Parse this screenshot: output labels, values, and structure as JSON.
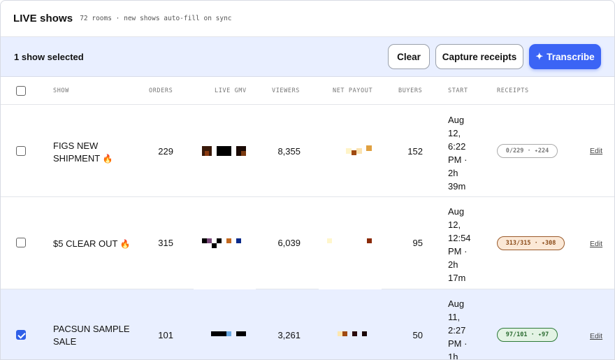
{
  "header": {
    "title": "LIVE shows",
    "subtitle": "72 rooms · new shows auto-fill on sync"
  },
  "actionbar": {
    "selected_label": "1 show selected",
    "clear_label": "Clear",
    "capture_label": "Capture receipts",
    "transcribe_label": "Transcribe",
    "transcribe_icon": "sparkle-icon"
  },
  "columns": {
    "show": "SHOW",
    "orders": "ORDERS",
    "live_gmv": "LIVE GMV",
    "viewers": "VIEWERS",
    "net_payout": "NET PAYOUT",
    "buyers": "BUYERS",
    "start": "START",
    "receipts": "RECEIPTS"
  },
  "rows": [
    {
      "checked": false,
      "show_line1": "FIGS NEW",
      "show_line2": "SHIPMENT",
      "flame": "🔥",
      "orders": "229",
      "viewers": "8,355",
      "buyers": "152",
      "start": [
        "Aug",
        "12,",
        "6:22",
        "PM ·",
        "2h",
        "39m"
      ],
      "receipts": "0/229 · ✦224",
      "edit": "Edit"
    },
    {
      "checked": false,
      "show_line1": "$5 CLEAR OUT",
      "flame": "🔥",
      "orders": "315",
      "viewers": "6,039",
      "buyers": "95",
      "start": [
        "Aug",
        "12,",
        "12:54",
        "PM ·",
        "2h",
        "17m"
      ],
      "receipts": "313/315 · ✦308",
      "edit": "Edit"
    },
    {
      "checked": true,
      "show_line1": "PACSUN SAMPLE",
      "show_line2": "SALE",
      "orders": "101",
      "viewers": "3,261",
      "buyers": "50",
      "start": [
        "Aug",
        "11,",
        "2:27",
        "PM ·",
        "1h"
      ],
      "receipts": "97/101 · ✦97",
      "edit": "Edit"
    }
  ],
  "colors": {
    "accent": "#3b64f5",
    "selected_bg": "#e9efff",
    "pill_green": "#2d7a38",
    "pill_orange": "#9a5a2a"
  }
}
